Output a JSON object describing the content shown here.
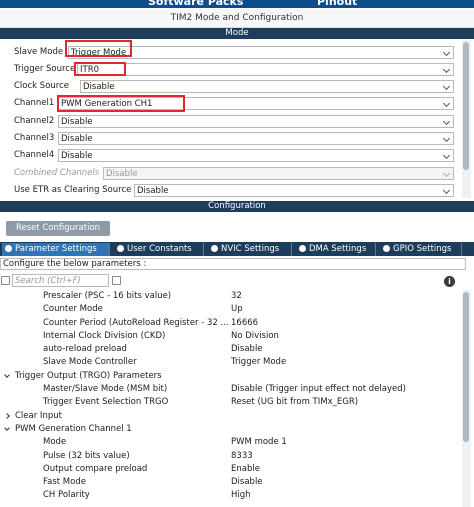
{
  "header": {
    "tab_left": "Software Packs",
    "tab_right": "Pinout",
    "window_title": "TIM2 Mode and Configuration"
  },
  "mode": {
    "section_title": "Mode",
    "rows": [
      {
        "label": "Slave Mode",
        "value": "Trigger Mode",
        "disabled": false
      },
      {
        "label": "Trigger Source",
        "value": "ITR0",
        "disabled": false
      },
      {
        "label": "Clock Source",
        "value": "Disable",
        "disabled": false
      },
      {
        "label": "Channel1",
        "value": "PWM Generation CH1",
        "disabled": false
      },
      {
        "label": "Channel2",
        "value": "Disable",
        "disabled": false
      },
      {
        "label": "Channel3",
        "value": "Disable",
        "disabled": false
      },
      {
        "label": "Channel4",
        "value": "Disable",
        "disabled": false
      },
      {
        "label": "Combined Channels",
        "value": "Disable",
        "disabled": true
      },
      {
        "label": "Use ETR as Clearing Source",
        "value": "Disable",
        "disabled": false
      }
    ]
  },
  "configuration": {
    "section_title": "Configuration",
    "reset_label": "Reset Configuration",
    "tabs": [
      {
        "label": "Parameter Settings",
        "active": true
      },
      {
        "label": "User Constants",
        "active": false
      },
      {
        "label": "NVIC Settings",
        "active": false
      },
      {
        "label": "DMA Settings",
        "active": false
      },
      {
        "label": "GPIO Settings",
        "active": false
      }
    ],
    "hint": "Configure the below parameters :",
    "search_placeholder": "Search (Ctrl+F)",
    "info_glyph": "i",
    "params": [
      {
        "name": "Prescaler (PSC - 16 bits value)",
        "value": "32",
        "level": 2
      },
      {
        "name": "Counter Mode",
        "value": "Up",
        "level": 2
      },
      {
        "name": "Counter Period (AutoReload Register - 32 ...",
        "value": "16666",
        "level": 2
      },
      {
        "name": "Internal Clock Division (CKD)",
        "value": "No Division",
        "level": 2
      },
      {
        "name": "auto-reload preload",
        "value": "Disable",
        "level": 2
      },
      {
        "name": "Slave Mode Controller",
        "value": "Trigger Mode",
        "level": 2
      },
      {
        "name": "Trigger Output (TRGO) Parameters",
        "value": "",
        "level": 1,
        "group": "open"
      },
      {
        "name": "Master/Slave Mode (MSM bit)",
        "value": "Disable (Trigger input effect not delayed)",
        "level": 2
      },
      {
        "name": "Trigger Event Selection TRGO",
        "value": "Reset (UG bit from TIMx_EGR)",
        "level": 2
      },
      {
        "name": "Clear Input",
        "value": "",
        "level": 1,
        "group": "closed"
      },
      {
        "name": "PWM Generation Channel 1",
        "value": "",
        "level": 1,
        "group": "open"
      },
      {
        "name": "Mode",
        "value": "PWM mode 1",
        "level": 2
      },
      {
        "name": "Pulse (32 bits value)",
        "value": "8333",
        "level": 2
      },
      {
        "name": "Output compare preload",
        "value": "Enable",
        "level": 2
      },
      {
        "name": "Fast Mode",
        "value": "Disable",
        "level": 2
      },
      {
        "name": "CH Polarity",
        "value": "High",
        "level": 2
      }
    ]
  },
  "colors": {
    "section_bar": "#1d3d5d",
    "active_tab": "#2f74b5",
    "highlight_box": "#e0282e"
  }
}
